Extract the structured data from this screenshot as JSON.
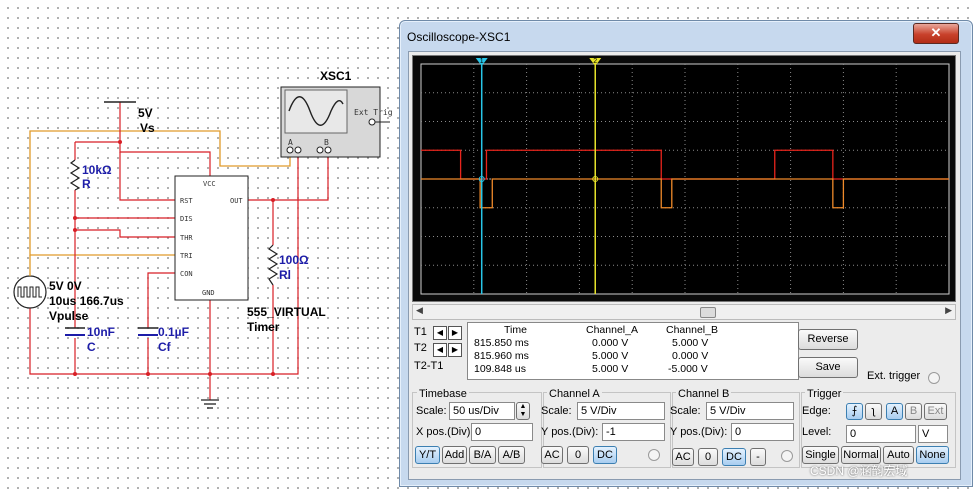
{
  "schematic": {
    "supply_value": "5V",
    "supply_name": "Vs",
    "r1_value": "10kΩ",
    "r1_name": "R",
    "rl_value": "100Ω",
    "rl_name": "Rl",
    "c_value": "10nF",
    "c_name": "C",
    "cf_value": "0.1µF",
    "cf_name": "Cf",
    "pulse_line1": "5V 0V",
    "pulse_line2": "10us 166.7us",
    "pulse_name": "Vpulse",
    "timer_line1": "555_VIRTUAL",
    "timer_line2": "Timer",
    "scope_name": "XSC1",
    "scope_ext_trig": "Ext Trig",
    "scope_a": "A",
    "scope_b": "B",
    "pins": {
      "vcc": "VCC",
      "rst": "RST",
      "dis": "DIS",
      "thr": "THR",
      "tri": "TRI",
      "con": "CON",
      "out": "OUT",
      "gnd": "GND"
    }
  },
  "window": {
    "title": "Oscilloscope-XSC1",
    "close_glyph": "✕"
  },
  "colors": {
    "channel_a": "#e8241c",
    "channel_b": "#ef8a2a",
    "cursor1": "#28c6e8",
    "cursor2": "#e8e42a",
    "grid": "#8a8a8a",
    "screen_bg": "#000000"
  },
  "chart_data": {
    "type": "line",
    "title": "",
    "xlabel": "",
    "ylabel": "",
    "grid": true,
    "x_unit": "Div",
    "xlim": [
      0,
      10
    ],
    "ylim": [
      -4,
      4
    ],
    "series": [
      {
        "name": "Channel_A",
        "color": "#e8241c",
        "points": [
          [
            0,
            1
          ],
          [
            0.75,
            1
          ],
          [
            0.75,
            0
          ],
          [
            1.24,
            0
          ],
          [
            1.24,
            1
          ],
          [
            4.55,
            1
          ],
          [
            4.55,
            0
          ],
          [
            6.7,
            0
          ],
          [
            6.7,
            1
          ],
          [
            7.8,
            1
          ],
          [
            7.8,
            0
          ],
          [
            10,
            0
          ]
        ]
      },
      {
        "name": "Channel_B",
        "color": "#ef8a2a",
        "points": [
          [
            0,
            0
          ],
          [
            1.12,
            0
          ],
          [
            1.12,
            -1
          ],
          [
            1.35,
            -1
          ],
          [
            1.35,
            0
          ],
          [
            4.55,
            0
          ],
          [
            4.55,
            -1
          ],
          [
            4.75,
            -1
          ],
          [
            4.75,
            0
          ],
          [
            7.8,
            0
          ],
          [
            7.8,
            -1
          ],
          [
            8.0,
            -1
          ],
          [
            8.0,
            0
          ],
          [
            10,
            0
          ]
        ]
      }
    ],
    "cursors": [
      {
        "name": "T1",
        "x": 1.15
      },
      {
        "name": "T2",
        "x": 3.3
      }
    ]
  },
  "readout": {
    "headers": {
      "time": "Time",
      "cha": "Channel_A",
      "chb": "Channel_B"
    },
    "rows": [
      {
        "label": "T1",
        "time": "815.850 ms",
        "cha": "0.000 V",
        "chb": "5.000 V"
      },
      {
        "label": "T2",
        "time": "815.960 ms",
        "cha": "5.000 V",
        "chb": "0.000 V"
      },
      {
        "label": "T2-T1",
        "time": "109.848 us",
        "cha": "5.000 V",
        "chb": "-5.000 V"
      }
    ]
  },
  "buttons": {
    "reverse": "Reverse",
    "save": "Save",
    "ext_trigger": "Ext. trigger"
  },
  "timebase": {
    "title": "Timebase",
    "scale_label": "Scale:",
    "scale_value": "50 us/Div",
    "xpos_label": "X pos.(Div):",
    "xpos_value": "0",
    "modes": [
      "Y/T",
      "Add",
      "B/A",
      "A/B"
    ],
    "active_mode": "Y/T"
  },
  "channel_a": {
    "title": "Channel A",
    "scale_label": "Scale:",
    "scale_value": "5  V/Div",
    "ypos_label": "Y pos.(Div):",
    "ypos_value": "-1",
    "coupling": [
      "AC",
      "0",
      "DC"
    ],
    "active": "DC"
  },
  "channel_b": {
    "title": "Channel B",
    "scale_label": "Scale:",
    "scale_value": "5  V/Div",
    "ypos_label": "Y pos.(Div):",
    "ypos_value": "0",
    "coupling": [
      "AC",
      "0",
      "DC",
      "-"
    ],
    "active": "DC"
  },
  "trigger": {
    "title": "Trigger",
    "edge_label": "Edge:",
    "edges": [
      "A",
      "B",
      "Ext"
    ],
    "level_label": "Level:",
    "level_value": "0",
    "level_unit": "V",
    "modes": [
      "Single",
      "Normal",
      "Auto",
      "None"
    ],
    "active_mode": "None"
  },
  "watermark": "CSDN @涵韵宏域"
}
